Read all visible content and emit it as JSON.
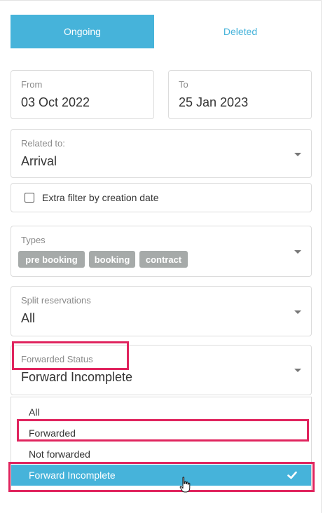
{
  "tabs": {
    "ongoing": "Ongoing",
    "deleted": "Deleted"
  },
  "date_range": {
    "from_label": "From",
    "from_value": "03 Oct 2022",
    "to_label": "To",
    "to_value": "25 Jan 2023"
  },
  "related_to": {
    "label": "Related to:",
    "value": "Arrival"
  },
  "extra_filter": {
    "label": "Extra filter by creation date",
    "checked": false
  },
  "types": {
    "label": "Types",
    "chips": [
      "pre booking",
      "booking",
      "contract"
    ]
  },
  "split_reservations": {
    "label": "Split reservations",
    "value": "All"
  },
  "forwarded_status": {
    "label": "Forwarded Status",
    "value": "Forward Incomplete",
    "options": [
      "All",
      "Forwarded",
      "Not forwarded",
      "Forward Incomplete"
    ],
    "selected_index": 3
  },
  "colors": {
    "accent": "#46b3da",
    "highlight": "#e0245e",
    "chip": "#a6aaa9"
  },
  "icons": {
    "caret": "chevron-down-icon",
    "check": "checkmark-icon",
    "cursor": "hand-pointer-icon"
  }
}
